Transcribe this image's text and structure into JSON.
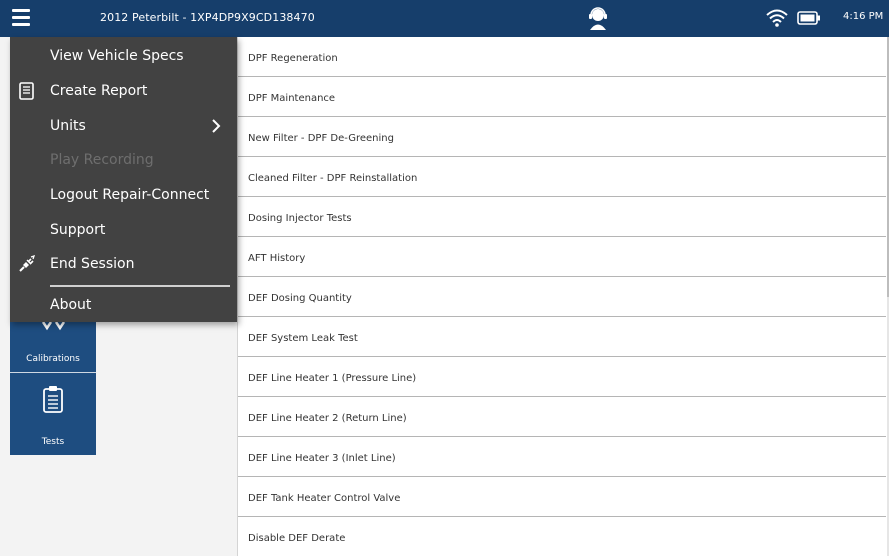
{
  "header": {
    "vehicle_title": "2012 Peterbilt - 1XP4DP9X9CD138470",
    "time": "4:16 PM"
  },
  "menu": {
    "items": [
      {
        "label": "View Vehicle Specs",
        "icon": "none",
        "enabled": true
      },
      {
        "label": "Create Report",
        "icon": "report-icon",
        "enabled": true
      },
      {
        "label": "Units",
        "icon": "none",
        "enabled": true,
        "submenu": true
      },
      {
        "label": "Play Recording",
        "icon": "none",
        "enabled": false
      },
      {
        "label": "Logout Repair-Connect",
        "icon": "none",
        "enabled": true
      },
      {
        "label": "Support",
        "icon": "none",
        "enabled": true
      },
      {
        "label": "End Session",
        "icon": "unplug-icon",
        "enabled": true
      },
      {
        "label": "About",
        "icon": "none",
        "enabled": true
      }
    ]
  },
  "sidebar": {
    "items": [
      {
        "label": "Calibrations",
        "icon": "checkmarks-icon"
      },
      {
        "label": "Tests",
        "icon": "clipboard-icon"
      }
    ]
  },
  "list": {
    "items": [
      "DPF Regeneration",
      "DPF Maintenance",
      "New Filter - DPF De-Greening",
      "Cleaned Filter - DPF Reinstallation",
      "Dosing Injector Tests",
      "AFT History",
      "DEF Dosing Quantity",
      "DEF System Leak Test",
      "DEF Line Heater 1 (Pressure Line)",
      "DEF Line Heater 2 (Return Line)",
      "DEF Line Heater 3 (Inlet Line)",
      "DEF Tank Heater Control Valve",
      "Disable DEF Derate"
    ]
  },
  "colors": {
    "header_bg": "#163e6b",
    "menu_bg": "#424242",
    "rail_bg": "#1e4d80",
    "disabled_text": "#6e6e6e"
  }
}
